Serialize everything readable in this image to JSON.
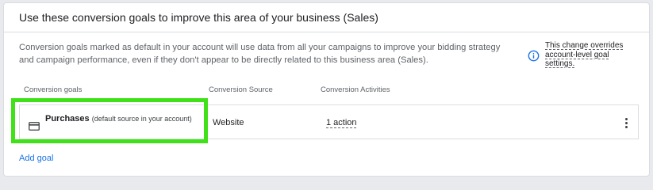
{
  "header": {
    "title": "Use these conversion goals to improve this area of your business (Sales)"
  },
  "description": "Conversion goals marked as default in your account will use data from all your campaigns to improve your bidding strategy and campaign performance, even if they don't appear to be directly related to this business area (Sales).",
  "notice": {
    "icon": "info-icon",
    "link_text": "This change overrides account-level goal settings."
  },
  "table": {
    "headers": [
      "Conversion goals",
      "Conversion Source",
      "Conversion Activities"
    ],
    "rows": [
      {
        "goal_icon": "credit-card-icon",
        "goal_name": "Purchases",
        "goal_note": "(default source in your account)",
        "source": "Website",
        "activities": "1 action",
        "menu_icon": "more-vert-icon"
      }
    ]
  },
  "add_goal_label": "Add goal",
  "colors": {
    "highlight": "#41e11a",
    "link": "#1a73e8",
    "border": "#dadce0"
  }
}
